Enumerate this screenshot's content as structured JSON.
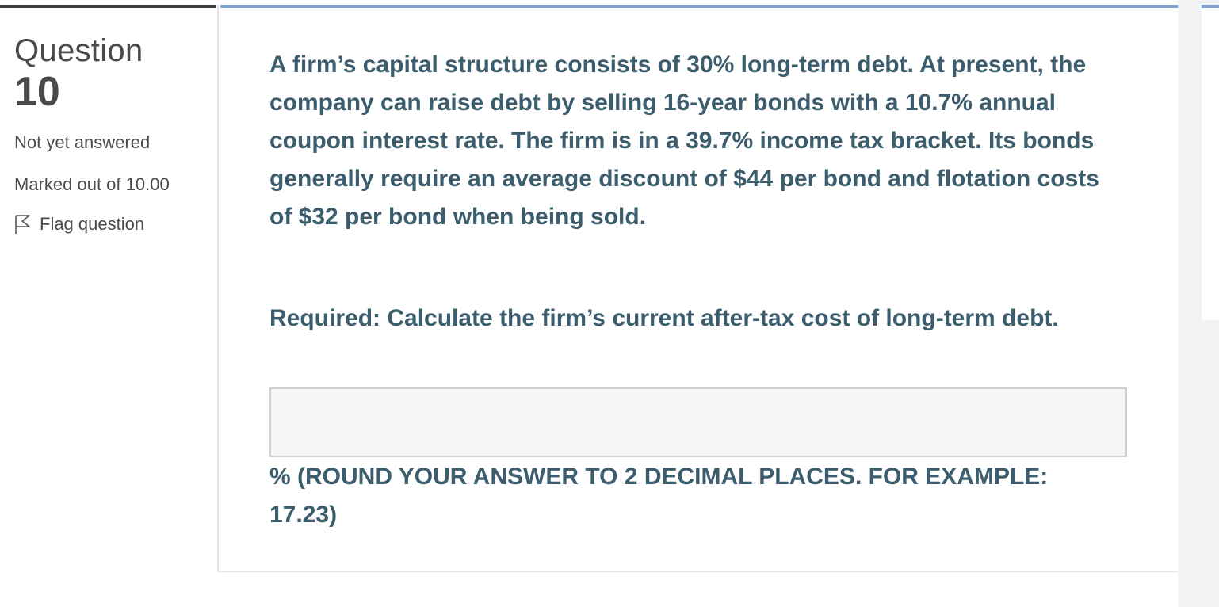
{
  "question_info": {
    "label": "Question",
    "number": "10",
    "state": "Not yet answered",
    "grade": "Marked out of 10.00",
    "flag_label": "Flag question"
  },
  "content": {
    "question_text": "A firm’s capital structure consists of 30% long-term debt. At present, the company can raise debt by selling 16-year bonds with a 10.7% annual coupon interest rate. The firm is in a 39.7% income tax bracket. Its bonds generally require an average discount of $44 per bond and flotation costs of $32 per bond when being sold.",
    "required_text": "Required: Calculate the firm’s current after-tax cost of long-term debt.",
    "answer_value": "",
    "answer_note": "% (ROUND YOUR ANSWER TO 2 DECIMAL PLACES. FOR EXAMPLE: 17.23)"
  },
  "colors": {
    "text_primary": "#3b5d6d",
    "text_info": "#4a4a4a",
    "accent_bar": "#7ea3cf",
    "answer_bg": "#f5f5f5"
  },
  "icons": {
    "flag": "flag-outline-icon"
  }
}
